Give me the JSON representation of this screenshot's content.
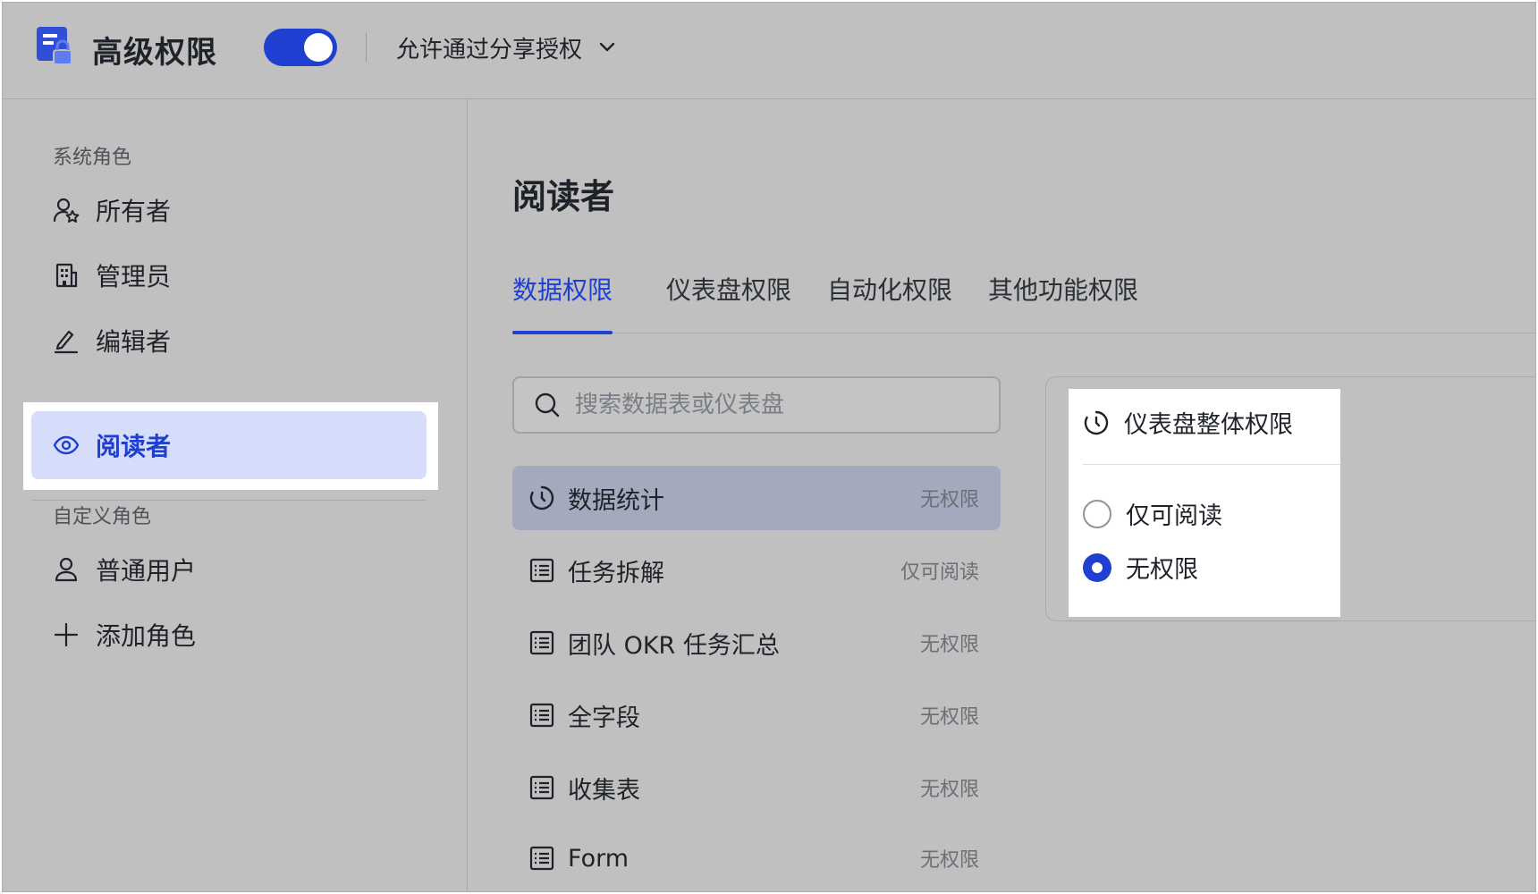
{
  "header": {
    "title": "高级权限",
    "toggle_on": true,
    "share_option": "允许通过分享授权"
  },
  "sidebar": {
    "system_roles_label": "系统角色",
    "system_roles": [
      {
        "label": "所有者",
        "icon": "owner-icon"
      },
      {
        "label": "管理员",
        "icon": "building-icon"
      },
      {
        "label": "编辑者",
        "icon": "edit-icon"
      },
      {
        "label": "阅读者",
        "icon": "eye-icon",
        "selected": true
      }
    ],
    "custom_roles_label": "自定义角色",
    "custom_roles": [
      {
        "label": "普通用户",
        "icon": "user-icon"
      }
    ],
    "add_role_label": "添加角色"
  },
  "main": {
    "title": "阅读者",
    "tabs": [
      {
        "label": "数据权限",
        "active": true
      },
      {
        "label": "仪表盘权限"
      },
      {
        "label": "自动化权限"
      },
      {
        "label": "其他功能权限"
      }
    ],
    "search_placeholder": "搜索数据表或仪表盘",
    "items": [
      {
        "name": "数据统计",
        "permission": "无权限",
        "icon": "dashboard-icon",
        "selected": true
      },
      {
        "name": "任务拆解",
        "permission": "仅可阅读",
        "icon": "table-icon"
      },
      {
        "name": "团队 OKR 任务汇总",
        "permission": "无权限",
        "icon": "table-icon"
      },
      {
        "name": "全字段",
        "permission": "无权限",
        "icon": "table-icon"
      },
      {
        "name": "收集表",
        "permission": "无权限",
        "icon": "table-icon"
      },
      {
        "name": "Form",
        "permission": "无权限",
        "icon": "table-icon"
      }
    ]
  },
  "panel": {
    "title": "仪表盘整体权限",
    "options": [
      {
        "label": "仅可阅读",
        "checked": false
      },
      {
        "label": "无权限",
        "checked": true
      }
    ]
  },
  "colors": {
    "accent": "#1f3fd1",
    "selected_bg": "#d6ddfb",
    "row_selected_bg": "#a4a9bd"
  }
}
